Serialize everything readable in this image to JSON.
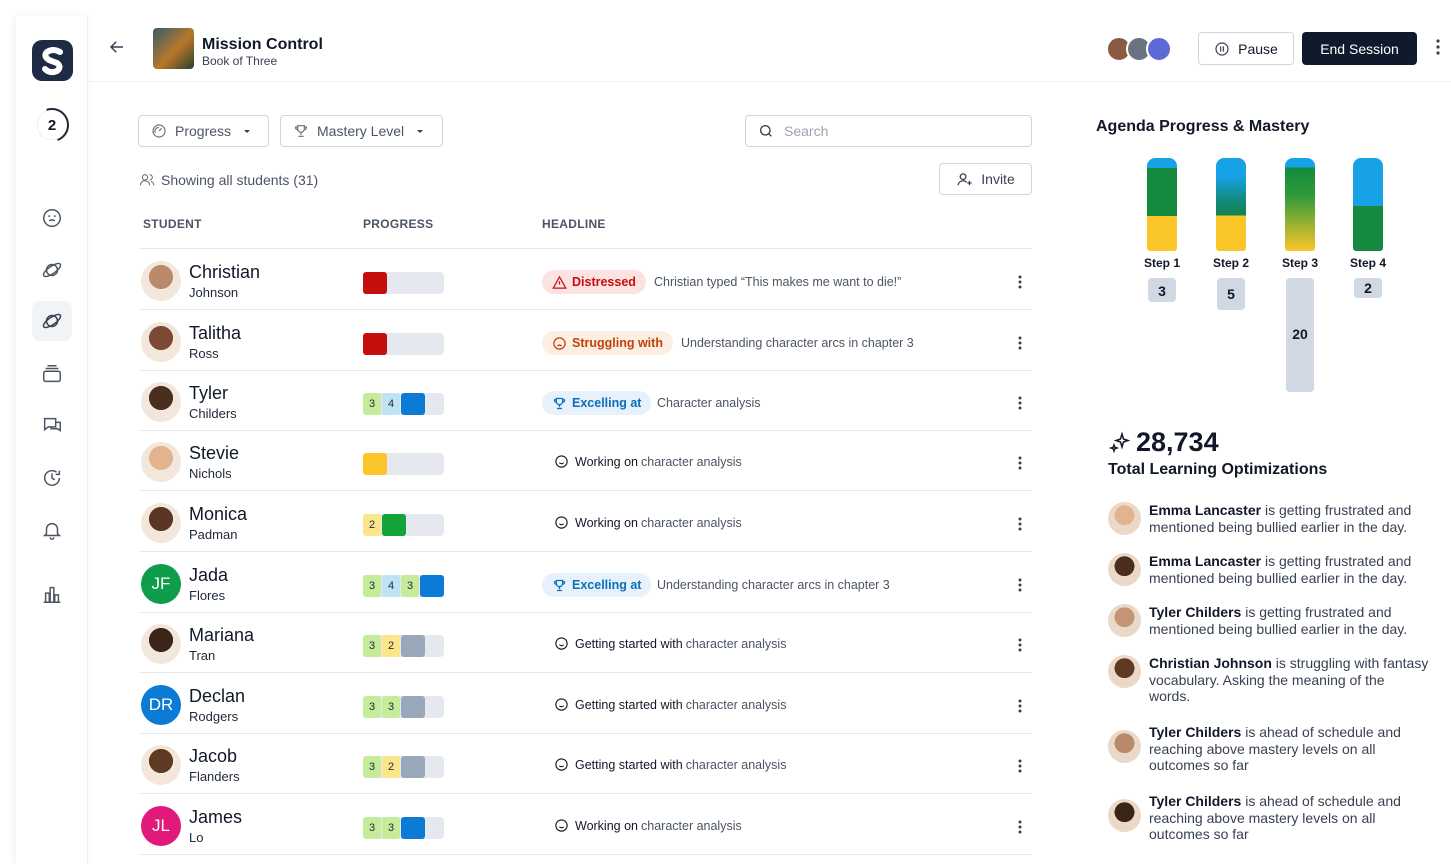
{
  "header": {
    "title": "Mission Control",
    "subtitle": "Book of Three",
    "pause_label": "Pause",
    "end_label": "End Session"
  },
  "sidebar": {
    "counter": "2"
  },
  "toolbar": {
    "progress_label": "Progress",
    "mastery_label": "Mastery Level",
    "search_placeholder": "Search",
    "showing": "Showing all students (31)",
    "invite_label": "Invite"
  },
  "table": {
    "headers": [
      "STUDENT",
      "PROGRESS",
      "HEADLINE"
    ],
    "rows": [
      {
        "first": "Christian",
        "last": "Johnson",
        "initials": "",
        "avatar_color": "#b98a6a",
        "progress": [
          {
            "label": "",
            "color": "#c70e0e",
            "fraction": 0.3
          }
        ],
        "tag": "Distressed",
        "tag_type": "distressed",
        "detail": "Christian typed “This makes me want to die!”"
      },
      {
        "first": "Talitha",
        "last": "Ross",
        "initials": "",
        "avatar_color": "#7a4a34",
        "progress": [
          {
            "label": "",
            "color": "#c70e0e",
            "fraction": 0.3
          }
        ],
        "tag": "Struggling with",
        "tag_type": "struggling",
        "detail": "Understanding character arcs in chapter 3"
      },
      {
        "first": "Tyler",
        "last": "Childers",
        "initials": "",
        "avatar_color": "#4a2e20",
        "progress": [
          {
            "label": "3",
            "color": "#c6ec9a"
          },
          {
            "label": "4",
            "color": "#bfe2f5"
          },
          {
            "label": "",
            "color": "#0b7bd6"
          }
        ],
        "tag": "Excelling at",
        "tag_type": "excelling",
        "detail": "Character analysis"
      },
      {
        "first": "Stevie",
        "last": "Nichols",
        "initials": "",
        "avatar_color": "#e2b48e",
        "progress": [
          {
            "label": "",
            "color": "#fbc62a",
            "fraction": 0.3
          }
        ],
        "tag": "Working on",
        "tag_type": "plain",
        "detail": "character analysis"
      },
      {
        "first": "Monica",
        "last": "Padman",
        "initials": "",
        "avatar_color": "#5a3624",
        "progress": [
          {
            "label": "2",
            "color": "#fde68a"
          },
          {
            "label": "",
            "color": "#12a43a"
          }
        ],
        "tag": "Working on",
        "tag_type": "plain",
        "detail": "character analysis"
      },
      {
        "first": "Jada",
        "last": "Flores",
        "initials": "JF",
        "avatar_color": "#0f9d4c",
        "progress": [
          {
            "label": "3",
            "color": "#c6ec9a"
          },
          {
            "label": "4",
            "color": "#bfe2f5"
          },
          {
            "label": "3",
            "color": "#c6ec9a"
          },
          {
            "label": "",
            "color": "#0b7bd6"
          }
        ],
        "tag": "Excelling at",
        "tag_type": "excelling",
        "detail": "Understanding character arcs in chapter 3"
      },
      {
        "first": "Mariana",
        "last": "Tran",
        "initials": "",
        "avatar_color": "#3b2518",
        "progress": [
          {
            "label": "3",
            "color": "#c6ec9a"
          },
          {
            "label": "2",
            "color": "#fde68a"
          },
          {
            "label": "",
            "color": "#9aa8bb"
          }
        ],
        "tag": "Getting started with",
        "tag_type": "plain",
        "detail": "character analysis"
      },
      {
        "first": "Declan",
        "last": "Rodgers",
        "initials": "DR",
        "avatar_color": "#0b7bd6",
        "progress": [
          {
            "label": "3",
            "color": "#c6ec9a"
          },
          {
            "label": "3",
            "color": "#c6ec9a"
          },
          {
            "label": "",
            "color": "#9aa8bb"
          }
        ],
        "tag": "Getting started with",
        "tag_type": "plain",
        "detail": "character analysis"
      },
      {
        "first": "Jacob",
        "last": "Flanders",
        "initials": "",
        "avatar_color": "#5e3a22",
        "progress": [
          {
            "label": "3",
            "color": "#c6ec9a"
          },
          {
            "label": "2",
            "color": "#fde68a"
          },
          {
            "label": "",
            "color": "#9aa8bb"
          }
        ],
        "tag": "Getting started with",
        "tag_type": "plain",
        "detail": "character analysis"
      },
      {
        "first": "James",
        "last": "Lo",
        "initials": "JL",
        "avatar_color": "#e0197a",
        "progress": [
          {
            "label": "3",
            "color": "#c6ec9a"
          },
          {
            "label": "3",
            "color": "#c6ec9a"
          },
          {
            "label": "",
            "color": "#0b7bd6"
          }
        ],
        "tag": "Working on",
        "tag_type": "plain",
        "detail": "character analysis"
      }
    ]
  },
  "agenda": {
    "title": "Agenda Progress & Mastery",
    "steps": [
      {
        "label": "Step 1",
        "count": "3"
      },
      {
        "label": "Step 2",
        "count": "5"
      },
      {
        "label": "Step 3",
        "count": "20"
      },
      {
        "label": "Step 4",
        "count": "2"
      }
    ]
  },
  "optimizations": {
    "count": "28,734",
    "label": "Total Learning Optimizations"
  },
  "feed": [
    {
      "name": "Emma Lancaster",
      "text": " is getting frustrated and mentioned being bullied earlier in the day.",
      "avatar_color": "#e2b48e"
    },
    {
      "name": "Emma Lancaster",
      "text": " is getting frustrated and mentioned being bullied earlier in the day.",
      "avatar_color": "#4a2e20"
    },
    {
      "name": "Tyler Childers",
      "text": " is getting frustrated and mentioned being bullied earlier in the day.",
      "avatar_color": "#c49474"
    },
    {
      "name": "Christian Johnson",
      "text": " is struggling with fantasy vocabulary. Asking the meaning of the words.",
      "avatar_color": "#5e3a22"
    },
    {
      "name": "Tyler Childers",
      "text": " is ahead of schedule and reaching above mastery levels on all outcomes so far",
      "avatar_color": "#b98a6a"
    },
    {
      "name": "Tyler Childers",
      "text": " is ahead of schedule and reaching above mastery levels on all outcomes so far",
      "avatar_color": "#3b2518"
    }
  ],
  "colors": {
    "accent": "#0f1b2d",
    "distressed": "#c70e0e",
    "struggling": "#c2410c",
    "excelling": "#0b6fb8"
  },
  "icons": [
    "back-arrow-icon",
    "pause-icon",
    "kebab-icon",
    "gauge-icon",
    "trophy-icon",
    "search-icon",
    "users-icon",
    "user-plus-icon",
    "warning-icon",
    "frown-icon",
    "smile-icon",
    "sparkle-icon"
  ]
}
